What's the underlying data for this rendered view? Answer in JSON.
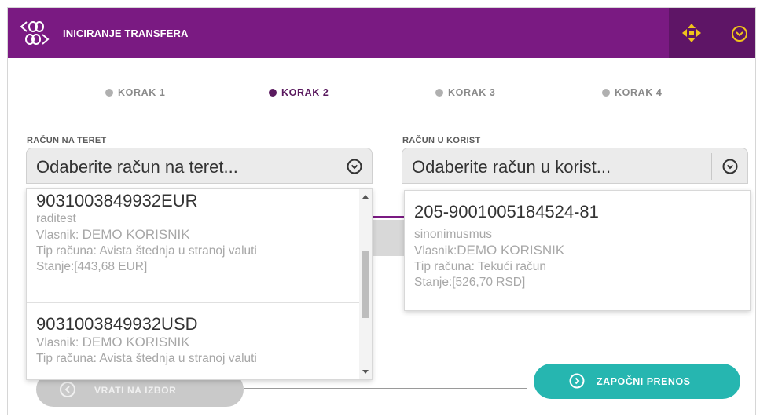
{
  "header": {
    "title": "INICIRANJE TRANSFERA"
  },
  "steps": [
    {
      "label": "KORAK 1",
      "active": false
    },
    {
      "label": "KORAK 2",
      "active": true
    },
    {
      "label": "KORAK 3",
      "active": false
    },
    {
      "label": "KORAK 4",
      "active": false
    }
  ],
  "debit": {
    "label": "RAČUN NA TERET",
    "placeholder": "Odaberite račun na teret...",
    "options": [
      {
        "account": "9031003849932EUR",
        "alias": "raditest",
        "owner_prefix": "Vlasnik: ",
        "owner": "DEMO KORISNIK",
        "type": "Tip računa: Avista štednja u stranoj valuti",
        "balance": "Stanje:[443,68 EUR]"
      },
      {
        "account": "9031003849932USD",
        "owner_prefix": "Vlasnik: ",
        "owner": "DEMO KORISNIK",
        "type": "Tip računa: Avista štednja u stranoj valuti"
      }
    ]
  },
  "credit": {
    "label": "RAČUN U KORIST",
    "placeholder": "Odaberite račun u korist...",
    "options": [
      {
        "account": "205-9001005184524-81",
        "alias": "sinonimusmus",
        "owner_prefix": "Vlasnik:",
        "owner": "DEMO KORISNIK",
        "type": "Tip računa: Tekući račun",
        "balance": "Stanje:[526,70 RSD]"
      }
    ]
  },
  "buttons": {
    "back": "VRATI NA IZBOR",
    "start": "ZAPOČNI PRENOS"
  },
  "colors": {
    "brand": "#7a1a82",
    "brand_dark": "#5e1566",
    "accent": "#26b6b0"
  }
}
